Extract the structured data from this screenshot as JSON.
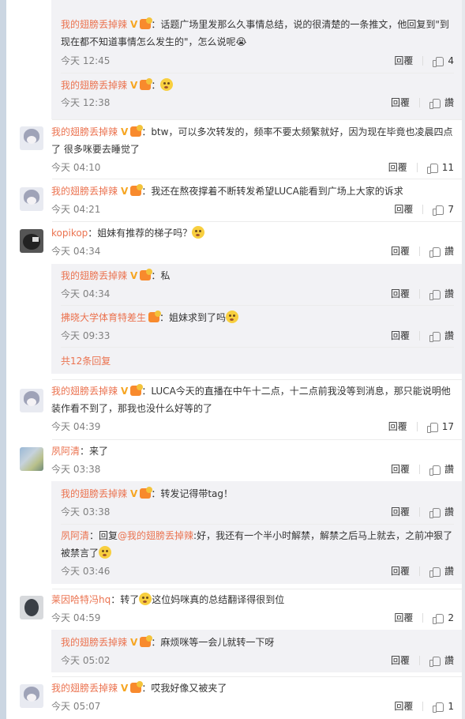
{
  "icons": {
    "verified": "verified-v-badge",
    "rank": "member-rank-badge",
    "like": "thumbs-up-icon",
    "emoji": "emoji-icon"
  },
  "colors": {
    "username": "#eb7350",
    "subreply_bg": "#f2f2f5"
  },
  "labels": {
    "reply": "回覆",
    "like_default": "讚"
  },
  "comments": [
    {
      "type": "sub",
      "user": "我的翅膀丢掉辣",
      "text1": "：话题广场里发那么久事情总结，说的很清楚的一条推文，他回复到\"到",
      "text2": "现在都不知道事情怎么发生的\"，怎么说呢😭",
      "time": "今天 12:45",
      "likes": "4"
    },
    {
      "type": "sub",
      "user": "我的翅膀丢掉辣",
      "text1": "：",
      "time": "今天 12:38",
      "likes": "讚"
    },
    {
      "type": "main",
      "user": "我的翅膀丢掉辣",
      "text1": "：btw，可以多次转发的，频率不要太频繁就好，因为现在毕竟也凌晨四点",
      "text2": "了 很多咪要去睡觉了",
      "time": "今天 04:10",
      "likes": "11"
    },
    {
      "type": "main",
      "user": "我的翅膀丢掉辣",
      "text1": "：我还在熬夜撑着不断转发希望LUCA能看到广场上大家的诉求",
      "time": "今天 04:21",
      "likes": "7"
    },
    {
      "type": "main",
      "user": "kopikop",
      "text1": "：姐妹有推荐的梯子吗？",
      "time": "今天 04:34",
      "likes": "讚"
    },
    {
      "type": "sub",
      "user": "我的翅膀丢掉辣",
      "text1": "：私",
      "time": "今天 04:34",
      "likes": "讚"
    },
    {
      "type": "sub",
      "user": "拂晓大学体育特差生",
      "text1": "：姐妹求到了吗",
      "time": "今天 09:33",
      "likes": "讚"
    },
    {
      "type": "more",
      "text1": "共12条回复"
    },
    {
      "type": "main",
      "user": "我的翅膀丢掉辣",
      "text1": "：LUCA今天的直播在中午十二点，十二点前我没等到消息，那只能说明他",
      "text2": "装作看不到了，那我也没什么好等的了",
      "time": "今天 04:39",
      "likes": "17"
    },
    {
      "type": "main",
      "user": "夙阿清",
      "text1": "：来了",
      "time": "今天 03:38",
      "likes": "讚"
    },
    {
      "type": "sub",
      "user": "我的翅膀丢掉辣",
      "text1": "：转发记得带tag！",
      "time": "今天 03:38",
      "likes": "讚"
    },
    {
      "type": "sub",
      "user": "夙阿清",
      "text1": "：回复",
      "mention": "@我的翅膀丢掉辣",
      "text1b": ":好，我还有一个半小时解禁，解禁之后马上就去，之前冲狠了",
      "text2": "被禁言了",
      "time": "今天 03:46",
      "likes": "讚"
    },
    {
      "type": "main",
      "user": "莱因哈特冯hq",
      "text1": "：转了",
      "text1b": "这位妈咪真的总结翻译得很到位",
      "time": "今天 04:59",
      "likes": "2"
    },
    {
      "type": "sub",
      "user": "我的翅膀丢掉辣",
      "text1": "：麻烦咪等一会儿就转一下呀",
      "time": "今天 05:02",
      "likes": "讚"
    },
    {
      "type": "main",
      "user": "我的翅膀丢掉辣",
      "text1": "：哎我好像又被夹了",
      "time": "今天 05:07",
      "likes": "1"
    }
  ]
}
